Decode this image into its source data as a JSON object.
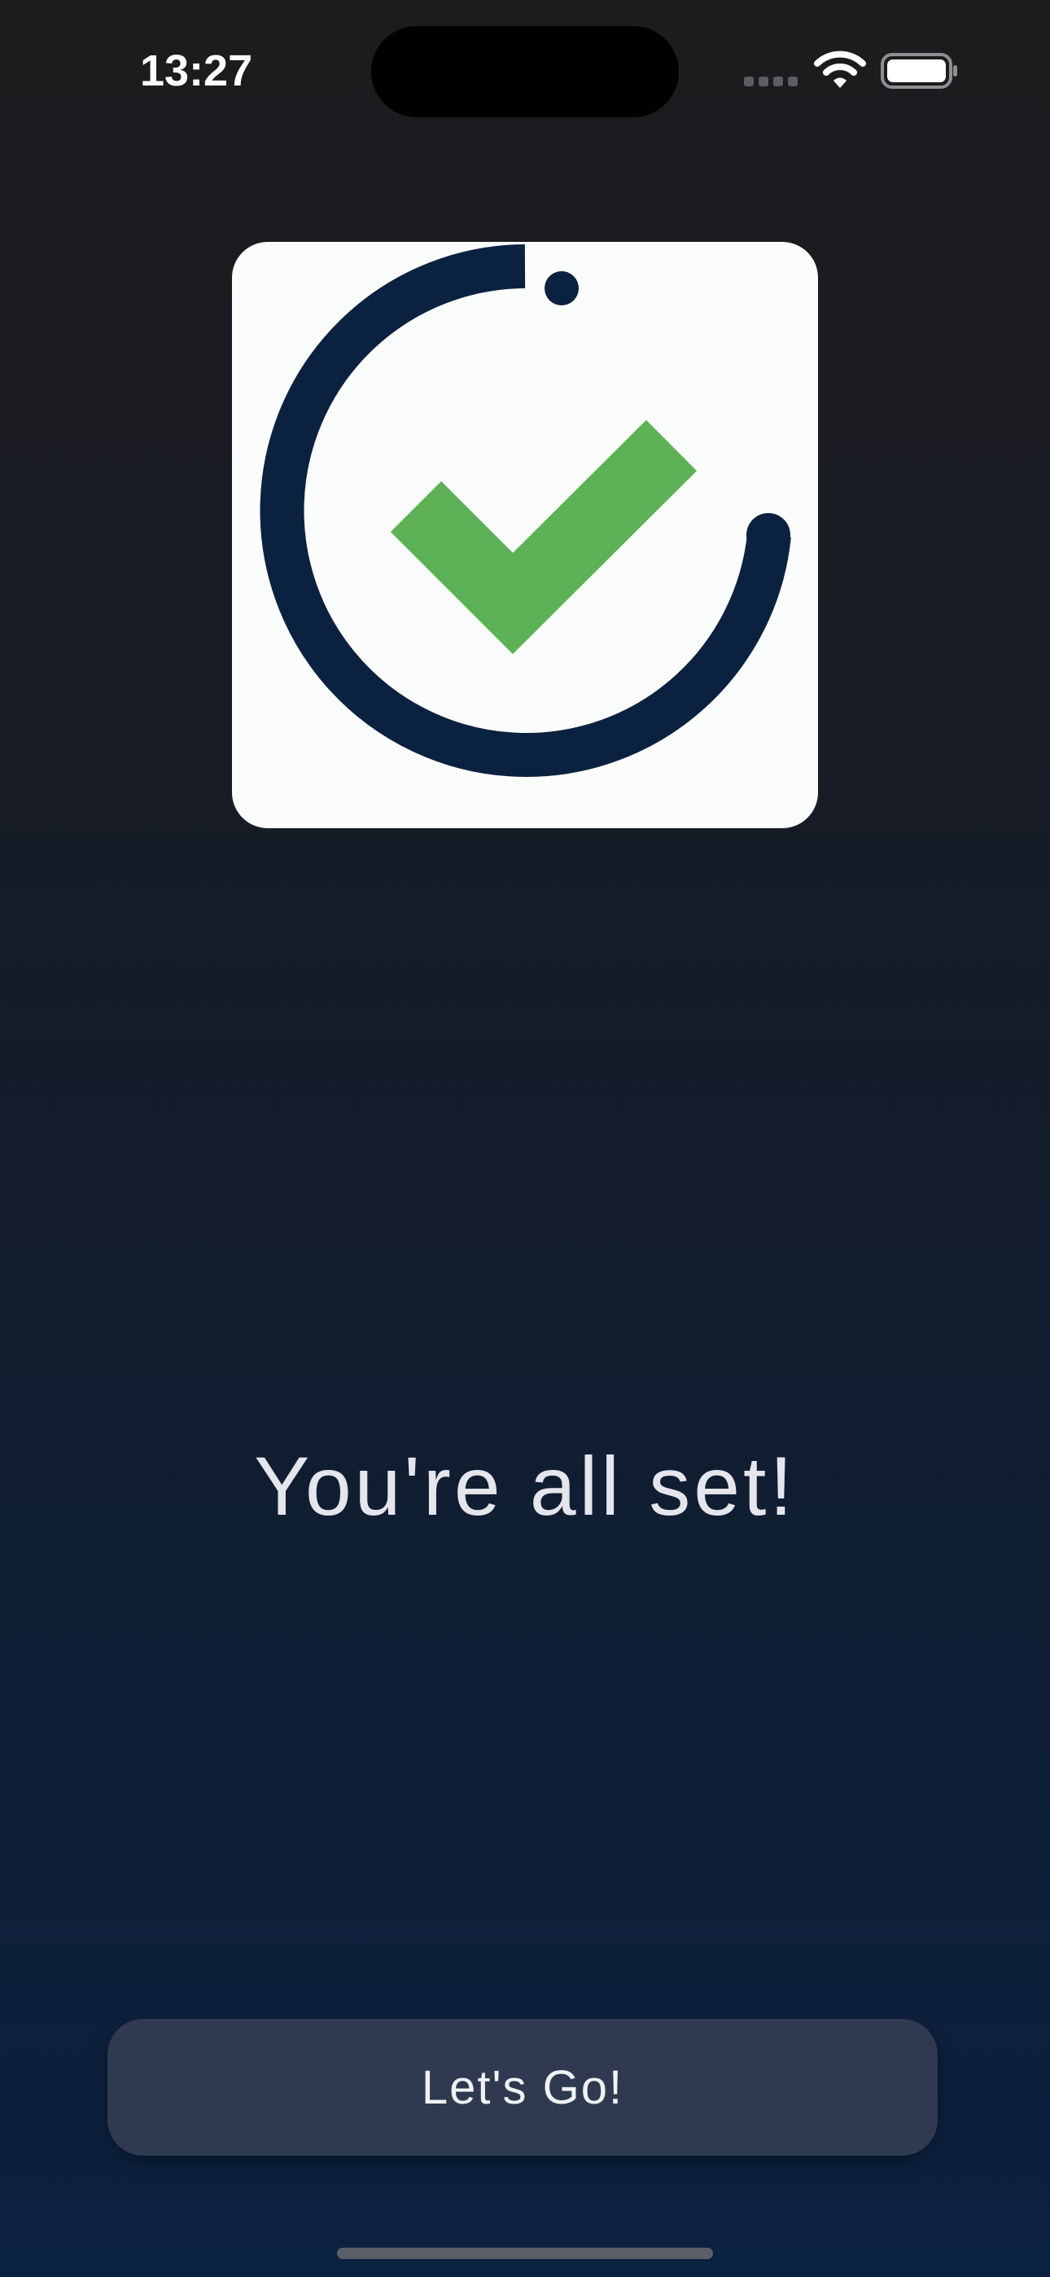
{
  "status_bar": {
    "time": "13:27",
    "icons": [
      "cellular-signal-icon",
      "wifi-icon",
      "battery-icon"
    ]
  },
  "logo": {
    "icon": "checkmark-circle-logo",
    "colors": {
      "ring": "#0b2140",
      "check": "#5cb254",
      "background": "#fbfcfc"
    }
  },
  "main": {
    "headline": "You're all set!"
  },
  "actions": {
    "primary_label": "Let's Go!"
  },
  "theme": {
    "background_top": "#1c1c1e",
    "background_bottom": "#0b2140",
    "button_background": "#2f3a50",
    "text_color": "#e4e6ec"
  }
}
